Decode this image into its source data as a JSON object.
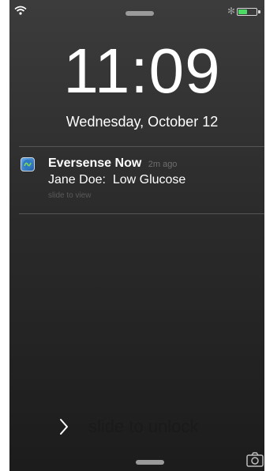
{
  "status_bar": {
    "wifi_icon": "wifi-icon",
    "bluetooth_icon": "bluetooth-icon",
    "bluetooth_glyph": "✻",
    "battery_icon": "battery-icon",
    "battery_level": 0.5,
    "battery_color": "#4cd964"
  },
  "lockscreen": {
    "time": "11:09",
    "date": "Wednesday, October 12"
  },
  "notification": {
    "app_name": "Eversense Now",
    "timestamp": "2m ago",
    "message": "Jane Doe:  Low Glucose",
    "action_hint": "slide to view",
    "app_icon": "eversense-app-icon"
  },
  "unlock": {
    "label": "slide to unlock",
    "chevron_icon": "chevron-right-icon"
  },
  "camera": {
    "icon": "camera-icon"
  }
}
